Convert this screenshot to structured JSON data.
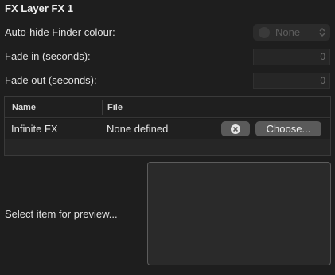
{
  "panel": {
    "title": "FX Layer FX 1"
  },
  "settings": {
    "autohide_label": "Auto-hide Finder colour:",
    "autohide_value": "None",
    "fade_in_label": "Fade in (seconds):",
    "fade_in_value": "0",
    "fade_out_label": "Fade out (seconds):",
    "fade_out_value": "0"
  },
  "table": {
    "columns": [
      "Name",
      "File"
    ],
    "rows": [
      {
        "name": "Infinite FX",
        "file": "None defined",
        "choose_label": "Choose..."
      }
    ]
  },
  "preview": {
    "label": "Select item for preview..."
  },
  "icons": {
    "popup_chevron": "up-down-chevron-icon",
    "clear": "clear-x-icon",
    "color_swatch": "color-swatch-icon"
  }
}
